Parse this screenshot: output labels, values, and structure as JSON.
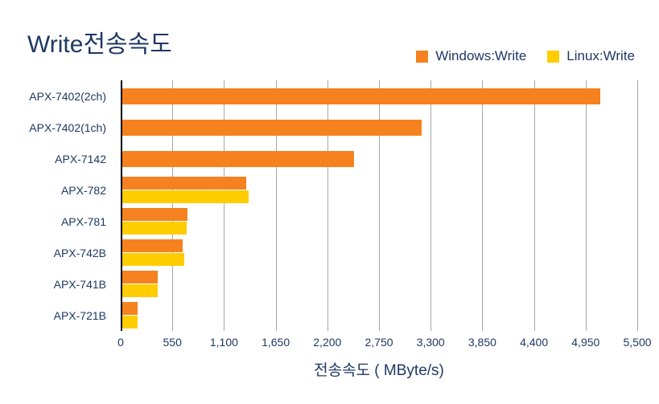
{
  "chart_data": {
    "type": "bar",
    "orientation": "horizontal",
    "title": "Write전송속도",
    "xlabel": "전송속도 ( MByte/s)",
    "ylabel": "",
    "xlim": [
      0,
      5500
    ],
    "xticks": [
      0,
      550,
      1100,
      1650,
      2200,
      2750,
      3300,
      3850,
      4400,
      4950,
      5500
    ],
    "xtick_labels": [
      "0",
      "550",
      "1,100",
      "1,650",
      "2,200",
      "2,750",
      "3,300",
      "3,850",
      "4,400",
      "4,950",
      "5,500"
    ],
    "grid": "vertical",
    "legend_position": "top-right",
    "categories": [
      "APX-7402(2ch)",
      "APX-7402(1ch)",
      "APX-7142",
      "APX-782",
      "APX-781",
      "APX-742B",
      "APX-741B",
      "APX-721B"
    ],
    "series": [
      {
        "name": "Windows:Write",
        "color": "#F5821F",
        "values": [
          5105,
          3200,
          2485,
          1335,
          710,
          660,
          390,
          180
        ]
      },
      {
        "name": "Linux:Write",
        "color": "#FFCD00",
        "values": [
          null,
          null,
          null,
          1365,
          700,
          680,
          395,
          180
        ]
      }
    ]
  },
  "legend": {
    "items": [
      {
        "label": "Windows:Write",
        "color": "#F5821F",
        "swatch_name": "legend-swatch-windows"
      },
      {
        "label": "Linux:Write",
        "color": "#FFCD00",
        "swatch_name": "legend-swatch-linux"
      }
    ]
  },
  "colors": {
    "windows_orange": "#F5821F",
    "linux_yellow": "#FFCD00",
    "text": "#1F3864",
    "gridline": "#A6A6A6",
    "axis": "#000000",
    "background": "#FFFFFF"
  }
}
